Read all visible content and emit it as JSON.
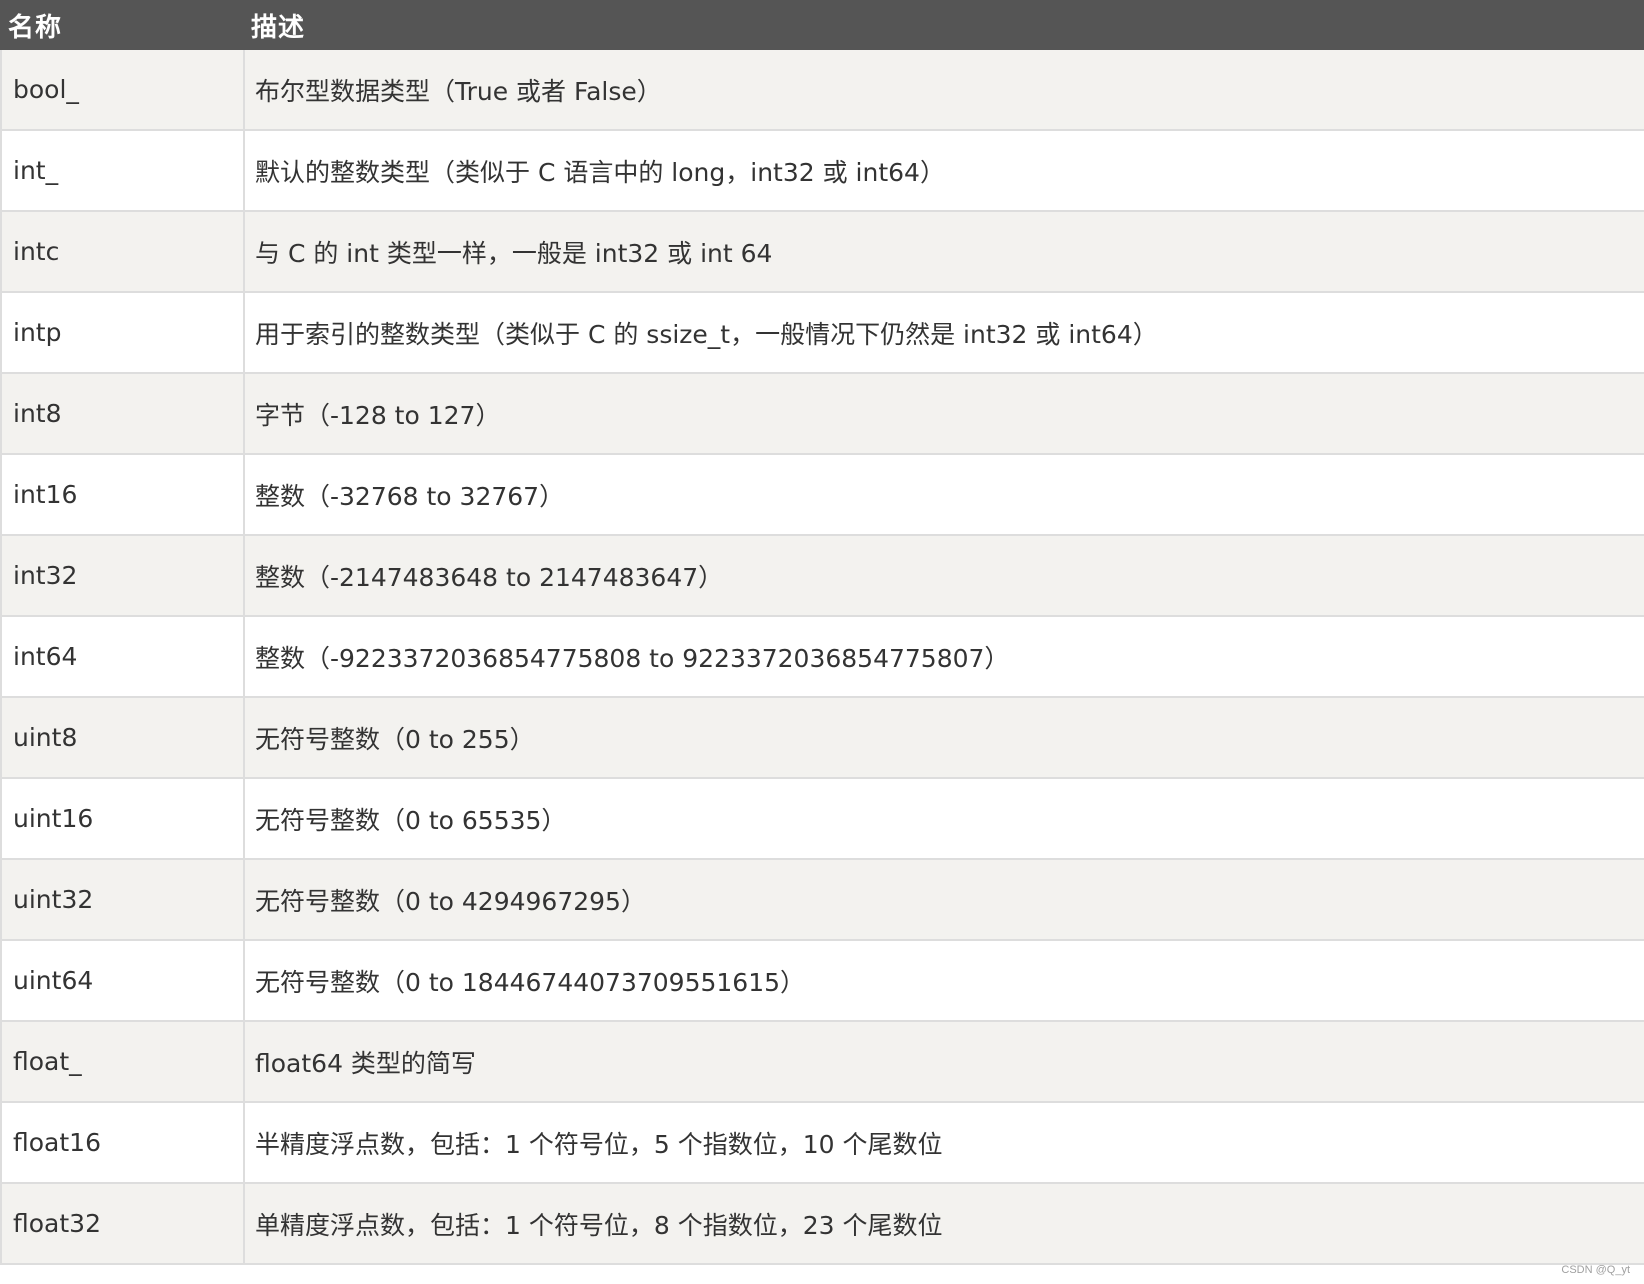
{
  "header": {
    "col_name": "名称",
    "col_desc": "描述"
  },
  "rows": [
    {
      "name": "bool_",
      "desc": "布尔型数据类型（True 或者 False）"
    },
    {
      "name": "int_",
      "desc": "默认的整数类型（类似于 C 语言中的 long，int32 或 int64）"
    },
    {
      "name": "intc",
      "desc": "与 C 的 int 类型一样，一般是 int32 或 int 64"
    },
    {
      "name": "intp",
      "desc": "用于索引的整数类型（类似于 C 的 ssize_t，一般情况下仍然是 int32 或 int64）"
    },
    {
      "name": "int8",
      "desc": "字节（-128 to 127）"
    },
    {
      "name": "int16",
      "desc": "整数（-32768 to 32767）"
    },
    {
      "name": "int32",
      "desc": "整数（-2147483648 to 2147483647）"
    },
    {
      "name": "int64",
      "desc": "整数（-9223372036854775808 to 9223372036854775807）"
    },
    {
      "name": "uint8",
      "desc": "无符号整数（0 to 255）"
    },
    {
      "name": "uint16",
      "desc": "无符号整数（0 to 65535）"
    },
    {
      "name": "uint32",
      "desc": "无符号整数（0 to 4294967295）"
    },
    {
      "name": "uint64",
      "desc": "无符号整数（0 to 18446744073709551615）"
    },
    {
      "name": "float_",
      "desc": "float64 类型的简写"
    },
    {
      "name": "float16",
      "desc": "半精度浮点数，包括：1 个符号位，5 个指数位，10 个尾数位"
    },
    {
      "name": "float32",
      "desc": "单精度浮点数，包括：1 个符号位，8 个指数位，23 个尾数位"
    }
  ],
  "watermark": "CSDN @Q_yt"
}
